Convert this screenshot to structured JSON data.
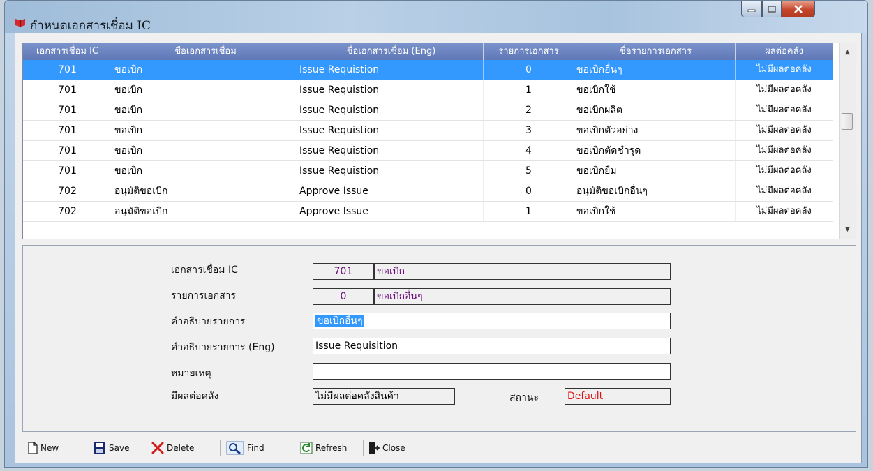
{
  "window": {
    "title": "กำหนดเอกสารเชื่อม IC"
  },
  "grid": {
    "headers": [
      "เอกสารเชื่อม IC",
      "ชื่อเอกสารเชื่อม",
      "ชื่อเอกสารเชื่อม (Eng)",
      "รายการเอกสาร",
      "ชื่อรายการเอกสาร",
      "ผลต่อคลัง"
    ],
    "rows": [
      [
        "701",
        "ขอเบิก",
        "Issue Requistion",
        "0",
        "ขอเบิกอื่นๆ",
        "ไม่มีผลต่อคลัง"
      ],
      [
        "701",
        "ขอเบิก",
        "Issue Requistion",
        "1",
        "ขอเบิกใช้",
        "ไม่มีผลต่อคลัง"
      ],
      [
        "701",
        "ขอเบิก",
        "Issue Requistion",
        "2",
        "ขอเบิกผลิต",
        "ไม่มีผลต่อคลัง"
      ],
      [
        "701",
        "ขอเบิก",
        "Issue Requistion",
        "3",
        "ขอเบิกตัวอย่าง",
        "ไม่มีผลต่อคลัง"
      ],
      [
        "701",
        "ขอเบิก",
        "Issue Requistion",
        "4",
        "ขอเบิกตัดชำรุด",
        "ไม่มีผลต่อคลัง"
      ],
      [
        "701",
        "ขอเบิก",
        "Issue Requistion",
        "5",
        "ขอเบิกยืม",
        "ไม่มีผลต่อคลัง"
      ],
      [
        "702",
        "อนุมัติขอเบิก",
        "Approve Issue",
        "0",
        "อนุมัติขอเบิกอื่นๆ",
        "ไม่มีผลต่อคลัง"
      ],
      [
        "702",
        "อนุมัติขอเบิก",
        "Approve Issue",
        "1",
        "ขอเบิกใช้",
        "ไม่มีผลต่อคลัง"
      ]
    ]
  },
  "form": {
    "doc_ic_label": "เอกสารเชื่อม IC",
    "doc_ic_code": "701",
    "doc_ic_name": "ขอเบิก",
    "doc_item_label": "รายการเอกสาร",
    "doc_item_code": "0",
    "doc_item_name": "ขอเบิกอื่นๆ",
    "desc_label": "คำอธิบายรายการ",
    "desc_value": "ขอเบิกอื่นๆ",
    "desc_eng_label": "คำอธิบายรายการ (Eng)",
    "desc_eng_value": "Issue Requisition",
    "remark_label": "หมายเหตุ",
    "remark_value": "",
    "stock_effect_label": "มีผลต่อคลัง",
    "stock_effect_value": "ไม่มีผลต่อคลังสินค้า",
    "status_label": "สถานะ",
    "status_value": "Default"
  },
  "toolbar": {
    "new": "New",
    "save": "Save",
    "delete": "Delete",
    "find": "Find",
    "refresh": "Refresh",
    "close": "Close"
  },
  "colors": {
    "selection": "#3399ff",
    "header": "#6a82c0",
    "status_text": "#e01010",
    "code_text": "#6b0d7a"
  }
}
